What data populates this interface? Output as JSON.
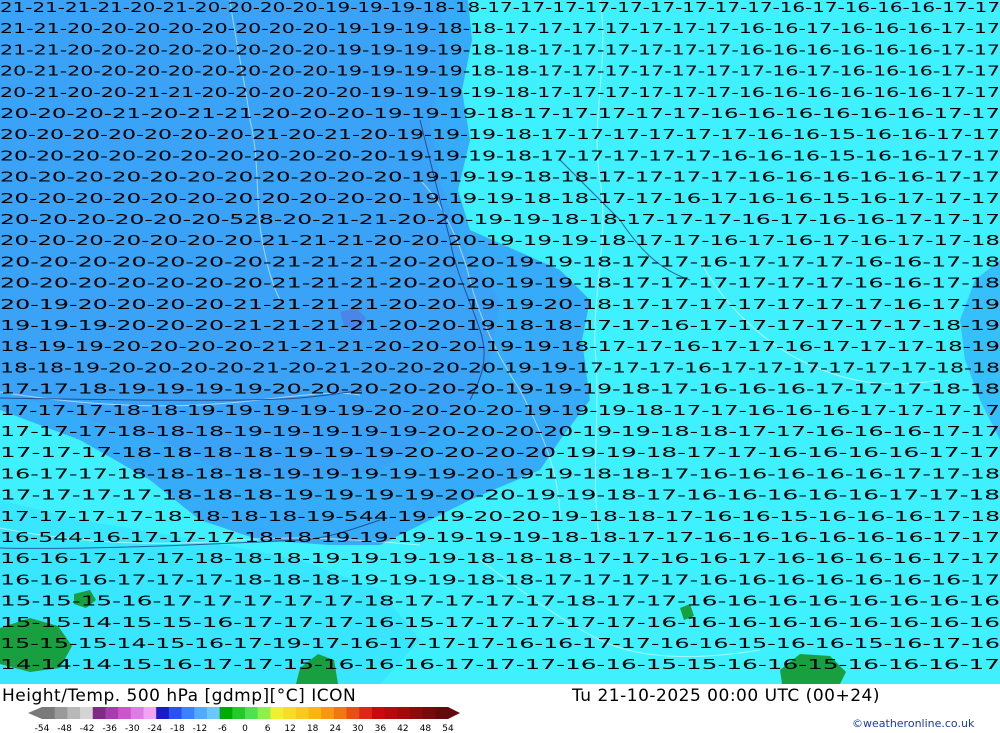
{
  "header": {
    "title": "Height/Temp. 500 hPa [gdmp][°C] ICON",
    "datetime": "Tu 21-10-2025 00:00 UTC (00+24)"
  },
  "credit": "©weatheronline.co.uk",
  "legend": {
    "ticks": [
      "-54",
      "-48",
      "-42",
      "-36",
      "-30",
      "-24",
      "-18",
      "-12",
      "-6",
      "0",
      "6",
      "12",
      "18",
      "24",
      "30",
      "36",
      "42",
      "48",
      "54"
    ],
    "colors": [
      "#7a7a7a",
      "#9a9a9a",
      "#b8b8b8",
      "#d4d4d4",
      "#7e2a86",
      "#a63cb0",
      "#cc55cc",
      "#e07ae6",
      "#f2a4f2",
      "#1a1ac8",
      "#2a52f0",
      "#3a82ff",
      "#52aaff",
      "#6ac8ff",
      "#00aa00",
      "#28c828",
      "#50e050",
      "#8cf050",
      "#f0f032",
      "#fadc28",
      "#fac81e",
      "#fab414",
      "#fa9614",
      "#f07814",
      "#e65014",
      "#dc2814",
      "#c80a0a",
      "#b40a0a",
      "#a00a0a",
      "#8c0a0a",
      "#780a0a",
      "#640a0a"
    ]
  },
  "map_colors": {
    "cold_fill": "#3ba6f8",
    "mid_fill": "#33c3fb",
    "warm_fill": "#3ff0ff",
    "land": "#18a040",
    "contour": "#ffffff",
    "highlight": "#4a86e8"
  },
  "contours": {
    "height_labels": [
      "528",
      "544",
      "544",
      "544"
    ]
  },
  "temperature_rows": [
    "21-21-21-21-20-21-20-20-20-20-19-19-19-18-18-17-17-17-17-17-17-17-17-17-16-17-16-16-16-17-17",
    "21-21-20-20-20-20-20-20-20-20-19-19-19-18-18-17-17-17-17-17-17-17-16-16-17-16-16-16-17-17",
    "21-21-20-20-20-20-20-20-20-20-19-19-19-19-18-18-17-17-17-17-17-17-16-16-16-16-16-16-17-17",
    "20-21-20-20-20-20-20-20-20-20-19-19-19-19-18-18-17-17-17-17-17-17-17-16-17-16-16-16-17-17",
    "20-21-20-20-21-21-20-20-20-20-20-19-19-19-19-18-17-17-17-17-17-17-16-16-16-16-16-16-17-17",
    "20-20-20-21-20-21-21-20-20-20-19-19-19-18-17-17-17-17-17-16-16-16-16-16-16-17-17",
    "20-20-20-20-20-20-20-21-20-21-20-19-19-19-18-17-17-17-17-17-17-16-16-15-16-16-17-17",
    "20-20-20-20-20-20-20-20-20-20-20-19-19-19-18-17-17-17-17-17-16-16-16-15-16-16-17-17",
    "20-20-20-20-20-20-20-20-20-20-20-19-19-19-18-18-17-17-17-17-16-16-16-16-16-17-17",
    "20-20-20-20-20-20-20-20-20-20-20-19-19-19-18-18-17-17-16-17-16-16-15-16-17-17-17",
    "20-20-20-20-20-20-528-20-21-21-20-20-19-19-18-18-17-17-17-16-17-16-16-17-17-17",
    "20-20-20-20-20-20-20-21-21-21-20-20-20-19-19-19-18-17-17-16-17-16-17-16-17-17-18",
    "20-20-20-20-20-20-20-21-21-21-20-20-20-19-19-18-17-17-16-17-17-17-16-16-17-18",
    "20-20-20-20-20-20-20-21-21-21-20-20-20-19-19-18-17-17-17-17-17-17-16-16-17-18",
    "20-19-20-20-20-20-21-21-21-21-20-20-19-19-20-18-17-17-17-17-17-17-17-16-17-19",
    "19-19-19-20-20-20-21-21-21-21-20-20-19-18-18-17-17-16-17-17-17-17-17-17-18-19",
    "18-19-19-20-20-20-20-21-21-21-20-20-20-19-19-18-17-17-16-17-17-16-17-17-17-18-19",
    "18-18-19-20-20-20-20-21-20-21-20-20-20-20-19-19-17-17-17-16-17-17-17-17-17-17-18-18",
    "17-17-18-19-19-19-19-20-20-20-20-20-20-19-19-19-18-17-16-16-16-17-17-17-18-18",
    "17-17-17-18-18-19-19-19-19-19-20-20-20-20-19-19-19-18-17-17-16-16-16-17-17-17-17",
    "17-17-17-18-18-18-19-19-19-19-19-20-20-20-20-19-19-18-18-17-17-16-16-16-17-17",
    "17-17-17-18-18-18-18-19-19-19-20-20-20-20-19-19-18-17-17-16-16-16-16-17-17",
    "16-17-17-18-18-18-18-19-19-19-19-19-20-19-19-18-18-17-16-16-16-16-16-17-17-18",
    "17-17-17-17-18-18-18-19-19-19-19-20-20-19-19-18-17-16-16-16-16-16-17-17-18",
    "17-17-17-17-18-18-18-18-19-544-19-19-20-20-19-18-18-17-16-16-15-16-16-16-17-18",
    "16-544-16-17-17-17-18-18-19-19-19-19-19-19-18-18-17-17-16-16-16-16-16-16-17-17",
    "16-16-17-17-17-18-18-18-19-19-19-19-18-18-18-17-17-16-16-17-16-16-16-16-17-17",
    "16-16-16-17-17-17-18-18-18-19-19-19-18-18-17-17-17-17-16-16-16-16-16-16-16-17",
    "15-15-15-16-17-17-17-17-17-18-17-17-17-17-18-17-17-16-16-16-16-16-16-16-16",
    "15-15-14-15-15-16-17-17-17-16-15-17-17-17-17-17-16-16-16-16-16-16-16-16-16",
    "15-15-15-14-15-16-17-19-17-16-17-17-17-16-16-17-17-16-16-15-16-16-15-16-17-16",
    "14-14-14-15-16-17-17-15-16-16-16-17-17-17-16-16-15-15-16-16-15-16-16-16-17"
  ]
}
